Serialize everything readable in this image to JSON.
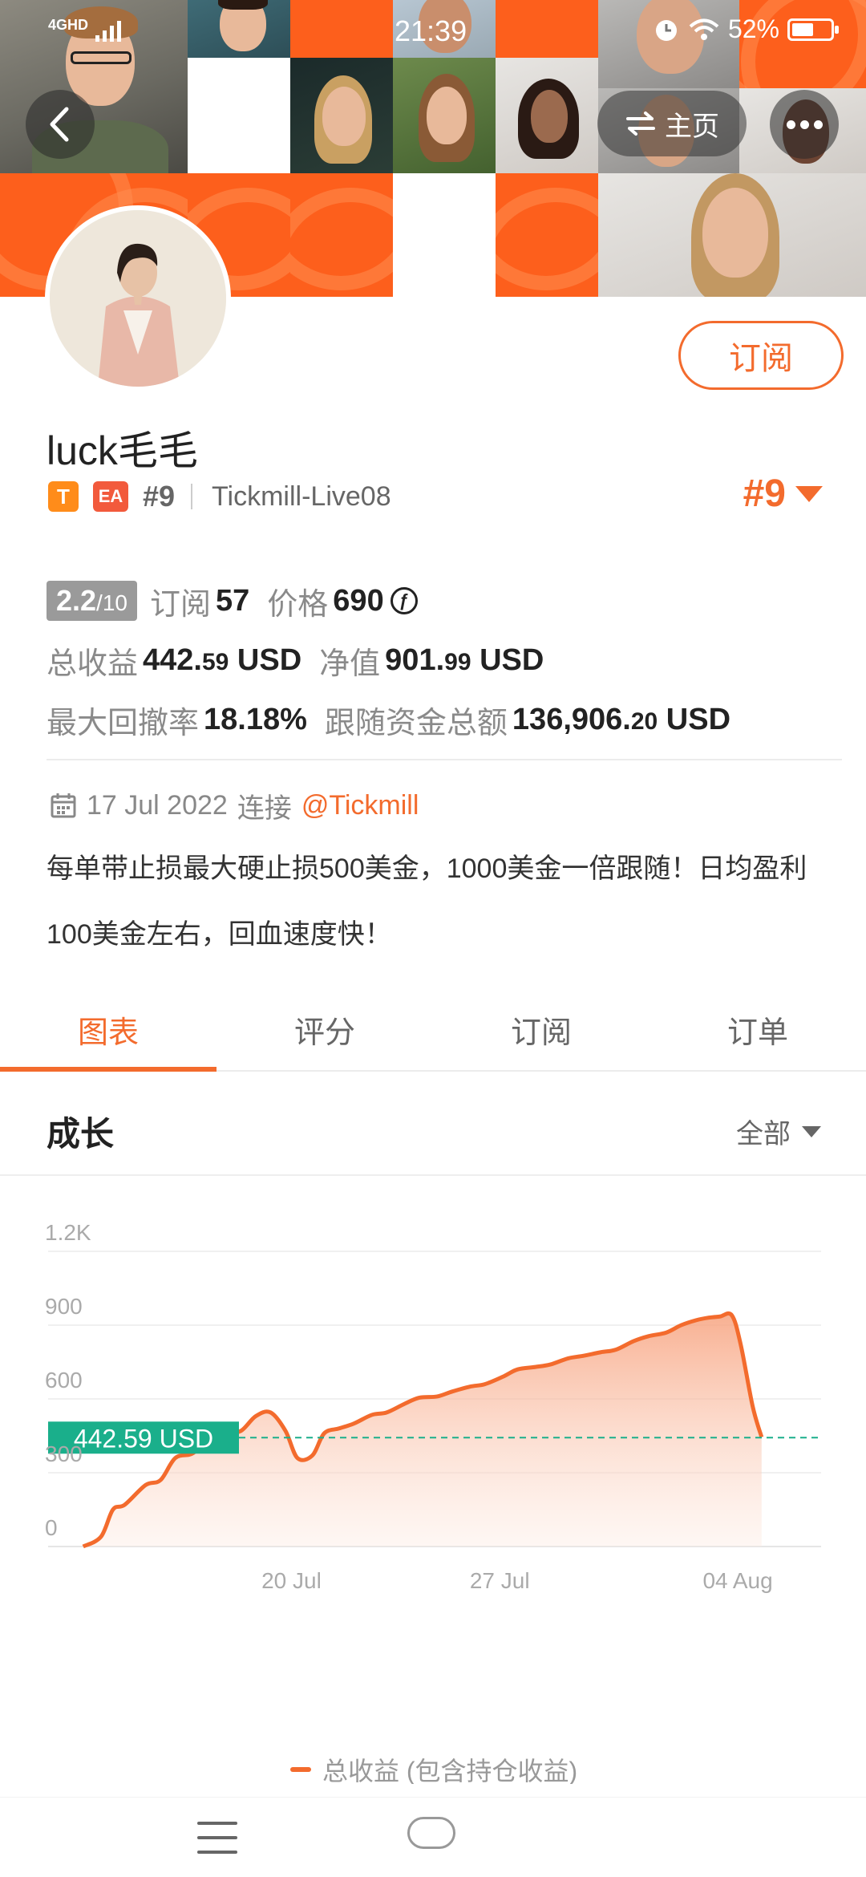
{
  "status_bar": {
    "network": "4GHD",
    "time": "21:39",
    "battery": "52%"
  },
  "header": {
    "home_label": "主页"
  },
  "profile": {
    "subscribe_label": "订阅",
    "name": "luck毛毛",
    "badge_t": "T",
    "badge_ea": "EA",
    "rank": "#9",
    "account": "Tickmill-Live08",
    "rank_right": "#9"
  },
  "stats": {
    "score": "2.2",
    "score_den": "/10",
    "subscribe_label": "订阅",
    "subscribe_count": "57",
    "price_label": "价格",
    "price_value": "690",
    "coin_symbol": "ƒ",
    "total_profit_label": "总收益",
    "total_profit_int": "442.",
    "total_profit_dec": "59",
    "total_profit_unit": "USD",
    "equity_label": "净值",
    "equity_int": "901.",
    "equity_dec": "99",
    "equity_unit": "USD",
    "drawdown_label": "最大回撤率",
    "drawdown_value": "18.18%",
    "follow_label": "跟随资金总额",
    "follow_int": "136,906.",
    "follow_dec": "20",
    "follow_unit": "USD"
  },
  "connect": {
    "date": "17 Jul 2022",
    "text": "连接",
    "broker": "@Tickmill"
  },
  "description": "每单带止损最大硬止损500美金，1000美金一倍跟随！日均盈利100美金左右，回血速度快！",
  "tabs": [
    {
      "label": "图表",
      "active": true
    },
    {
      "label": "评分",
      "active": false
    },
    {
      "label": "订阅",
      "active": false
    },
    {
      "label": "订单",
      "active": false
    }
  ],
  "chart_section": {
    "title": "成长",
    "range_label": "全部"
  },
  "chart_data": {
    "type": "area",
    "y_ticks": [
      "0",
      "300",
      "600",
      "900",
      "1.2K"
    ],
    "y_tick_values": [
      0,
      300,
      600,
      900,
      1200
    ],
    "ylim": [
      0,
      1200
    ],
    "x_ticks": [
      "20 Jul",
      "27 Jul",
      "04 Aug"
    ],
    "x_tick_days": [
      3,
      10,
      18
    ],
    "xlim_days": [
      -4.1,
      20.8
    ],
    "current_label": "442.59 USD",
    "current_value": 442.59,
    "legend": "总收益 (包含持仓收益)",
    "color": "#f36b2d",
    "reference_color": "#1aaf8b",
    "series": [
      {
        "name": "总收益 (包含持仓收益)",
        "x": [
          -4.0,
          -3.4,
          -3.0,
          -2.6,
          -1.9,
          -1.4,
          -0.9,
          -0.3,
          0.2,
          0.8,
          1.3,
          1.8,
          2.3,
          2.8,
          3.2,
          3.7,
          4.1,
          4.6,
          5.1,
          5.7,
          6.2,
          6.8,
          7.3,
          7.9,
          8.4,
          9.0,
          9.5,
          10.1,
          10.6,
          11.2,
          11.7,
          12.3,
          12.8,
          13.4,
          13.9,
          14.5,
          15.0,
          15.6,
          16.1,
          16.6,
          17.0,
          17.4,
          17.8,
          18.1,
          18.5,
          18.8
        ],
        "y": [
          0,
          40,
          150,
          170,
          250,
          270,
          360,
          380,
          450,
          465,
          470,
          530,
          545,
          470,
          360,
          370,
          460,
          480,
          500,
          535,
          545,
          580,
          605,
          610,
          630,
          650,
          660,
          690,
          720,
          730,
          740,
          765,
          775,
          790,
          800,
          835,
          855,
          870,
          900,
          920,
          930,
          935,
          940,
          820,
          570,
          445
        ]
      }
    ]
  }
}
